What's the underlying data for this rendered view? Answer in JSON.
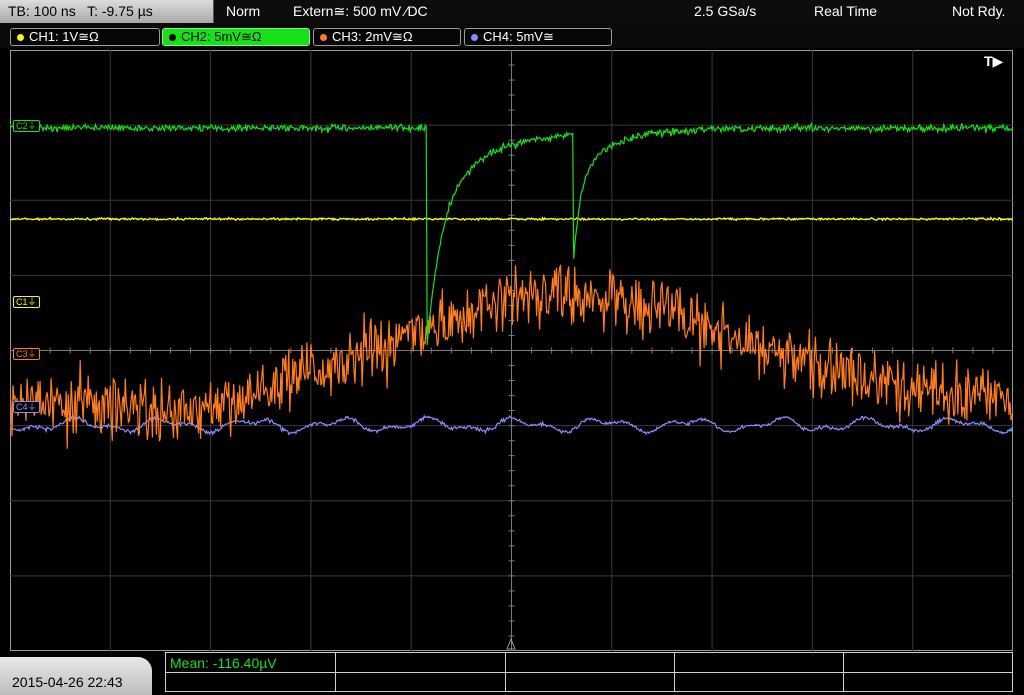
{
  "status": {
    "timebase": "TB: 100 ns   T: -9.75 µs",
    "mode": "Norm",
    "trigger": "Extern≅: 500 mV ⁄DC",
    "sample_rate": "2.5 GSa/s",
    "acq_mode": "Real Time",
    "trigger_state": "Not Rdy."
  },
  "channels": [
    {
      "label": "CH1: 1V≅Ω",
      "color": "#f5f51e"
    },
    {
      "label": "CH2: 5mV≅Ω",
      "color": "#18e018"
    },
    {
      "label": "CH3: 2mV≅Ω",
      "color": "#ff7d1e"
    },
    {
      "label": "CH4: 5mV≅",
      "color": "#8a8aff"
    }
  ],
  "markers": {
    "trigger_pos": "T▶",
    "ch1": "C1⏚",
    "ch2": "C2⏚",
    "ch3": "C3⏚",
    "ch4": "C4⏚"
  },
  "measurement": "Mean: -116.40µV",
  "datetime": "2015-04-26 22:43",
  "colors": {
    "ch1": "#f5f51e",
    "ch2": "#18e018",
    "ch3": "#ff7d1e",
    "ch4": "#8a8aff",
    "grid": "#3a3a3a",
    "grid_axis": "#7a7a7a"
  }
}
